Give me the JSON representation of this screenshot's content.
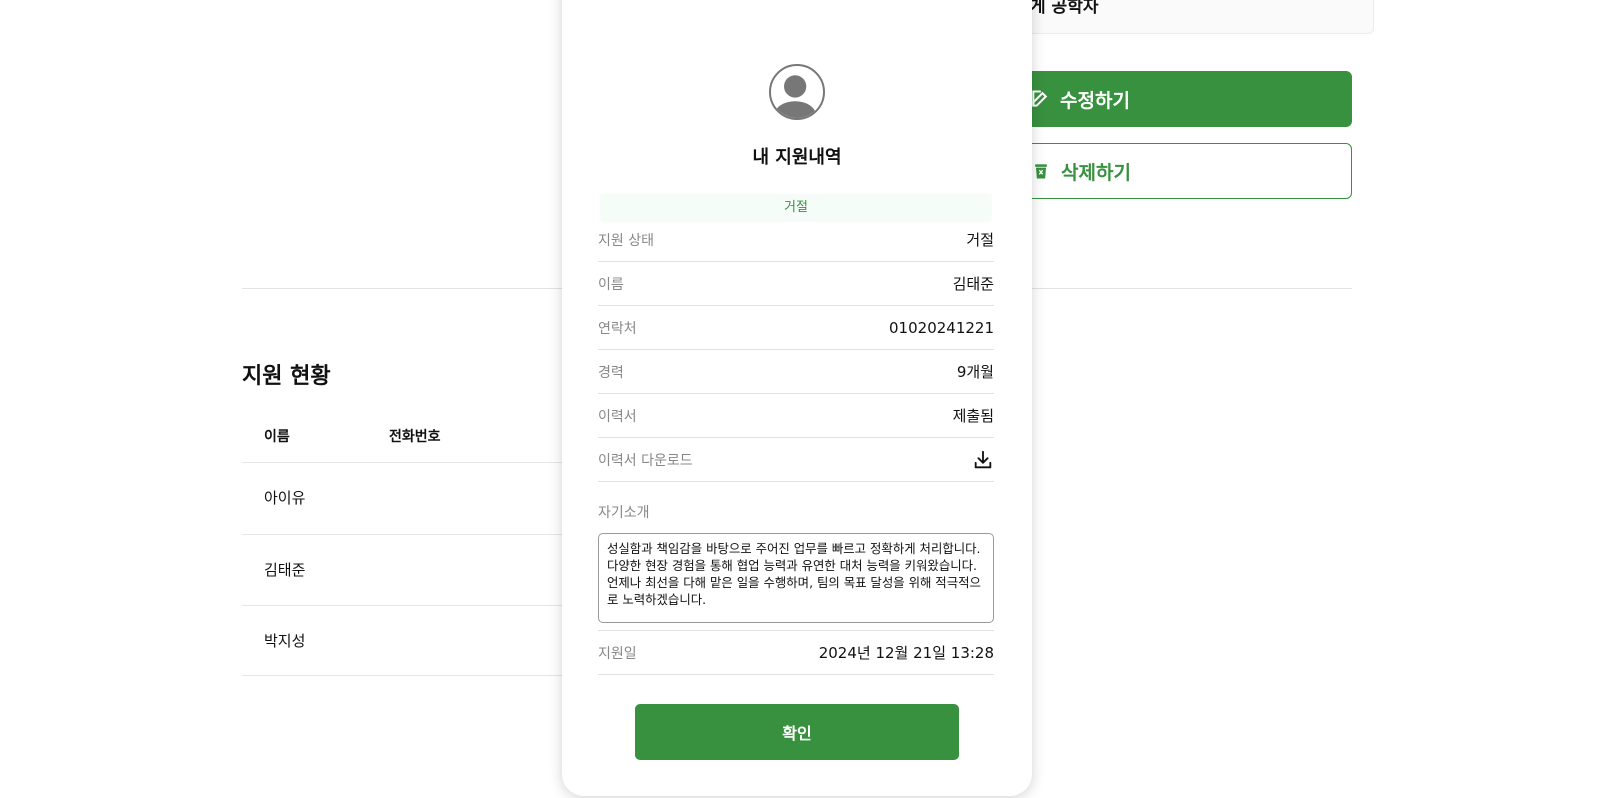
{
  "background": {
    "info_text": "게 공학자",
    "edit_button": "수정하기",
    "delete_button": "삭제하기",
    "section_title": "지원 현황",
    "table": {
      "headers": [
        "이름",
        "전화번호"
      ],
      "rows": [
        "아이유",
        "김태준",
        "박지성"
      ]
    }
  },
  "modal": {
    "title": "내 지원내역",
    "status_pill": "거절",
    "fields": {
      "status": {
        "label": "지원 상태",
        "value": "거절"
      },
      "name": {
        "label": "이름",
        "value": "김태준"
      },
      "phone": {
        "label": "연락처",
        "value": "01020241221"
      },
      "career": {
        "label": "경력",
        "value": "9개월"
      },
      "resume": {
        "label": "이력서",
        "value": "제출됨"
      },
      "download": {
        "label": "이력서 다운로드",
        "icon": "download-icon"
      },
      "date": {
        "label": "지원일",
        "value": "2024년 12월 21일 13:28"
      }
    },
    "intro_label": "자기소개",
    "intro_text": "성실함과 책임감을 바탕으로 주어진 업무를 빠르고 정확하게 처리합니다. 다양한 현장 경험을 통해 협업 능력과 유연한 대처 능력을 키워왔습니다. 언제나 최선을 다해 맡은 일을 수행하며, 팀의 목표 달성을 위해 적극적으로 노력하겠습니다.",
    "confirm_button": "확인"
  },
  "colors": {
    "accent": "#38913e"
  }
}
